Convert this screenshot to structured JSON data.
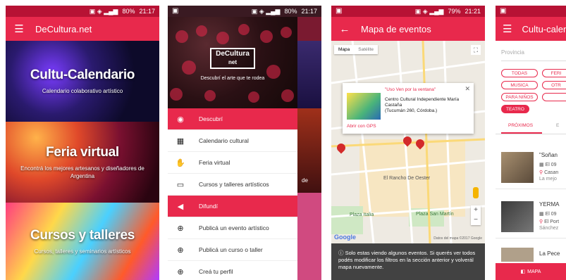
{
  "colors": {
    "accent": "#e8294c",
    "status_bar": "#b71234"
  },
  "phone1": {
    "status_time": "21:17",
    "status_battery": "80%",
    "app_title": "DeCultura.net",
    "cards": [
      {
        "title": "Cultu-Calendario",
        "subtitle": "Calendario colaborativo artístico"
      },
      {
        "title": "Feria virtual",
        "subtitle": "Encontrá los mejores artesanos y diseñadores de Argentina"
      },
      {
        "title": "Cursos y talleres",
        "subtitle": "Cursos, talleres y seminarios artísticos"
      }
    ]
  },
  "phone2": {
    "status_time": "21:17",
    "status_battery": "80%",
    "logo_line1": "DeCultura",
    "logo_line2": "net",
    "tagline": "Descubrí el arte que te rodea",
    "side_peek_text": "de",
    "menu": [
      {
        "label": "Descubrí",
        "icon": "eye-icon",
        "section": true
      },
      {
        "label": "Calendario cultural",
        "icon": "calendar-icon",
        "section": false
      },
      {
        "label": "Feria virtual",
        "icon": "hand-icon",
        "section": false
      },
      {
        "label": "Cursos y talleres artísticos",
        "icon": "book-icon",
        "section": false
      },
      {
        "label": "Difundí",
        "icon": "megaphone-icon",
        "section": true
      },
      {
        "label": "Publicá un evento artístico",
        "icon": "add-circle-icon",
        "section": false
      },
      {
        "label": "Publicá un curso o taller",
        "icon": "add-circle-icon",
        "section": false
      },
      {
        "label": "Creá tu perfil",
        "icon": "add-circle-icon",
        "section": false
      }
    ]
  },
  "phone3": {
    "status_time": "21:21",
    "status_battery": "79%",
    "app_title": "Mapa de eventos",
    "map_types": [
      "Mapa",
      "Satélite"
    ],
    "popup": {
      "title": "\"Uso Ven por la ventana\"",
      "venue": "Centro Cultural Independiente María Castaña",
      "address": "(Tucumán 260, Córdoba.)",
      "link": "Abrir con GPS"
    },
    "map_labels": [
      "El Rancho De Oester",
      "Plaza Italia",
      "Plaza San Martín"
    ],
    "google_label": "Google",
    "map_credit": "Datos del mapa ©2017 Google",
    "note": "Solo estas viendo algunos eventos. Si querés ver todos podés modificar los filtros en la sección anterior y volverál mapa nuevamente."
  },
  "phone4": {
    "app_title": "Cultu-calen",
    "province_placeholder": "Provincia",
    "chips": [
      "TODAS",
      "FERI",
      "MUSICA",
      "OTR",
      "PARA NIÑOS",
      "TEATRO"
    ],
    "tabs": [
      "PRÓXIMOS",
      "E"
    ],
    "events": [
      {
        "title": "\"Soñan",
        "date": "El 09",
        "place": "Casan",
        "extra": "La mejo"
      },
      {
        "title": "YERMA",
        "date": "El 09",
        "place": "El Port",
        "extra": "Sánchez"
      },
      {
        "title": "La Pece",
        "date": "",
        "place": "",
        "extra": ""
      }
    ],
    "bottom_button": "MAPA"
  }
}
